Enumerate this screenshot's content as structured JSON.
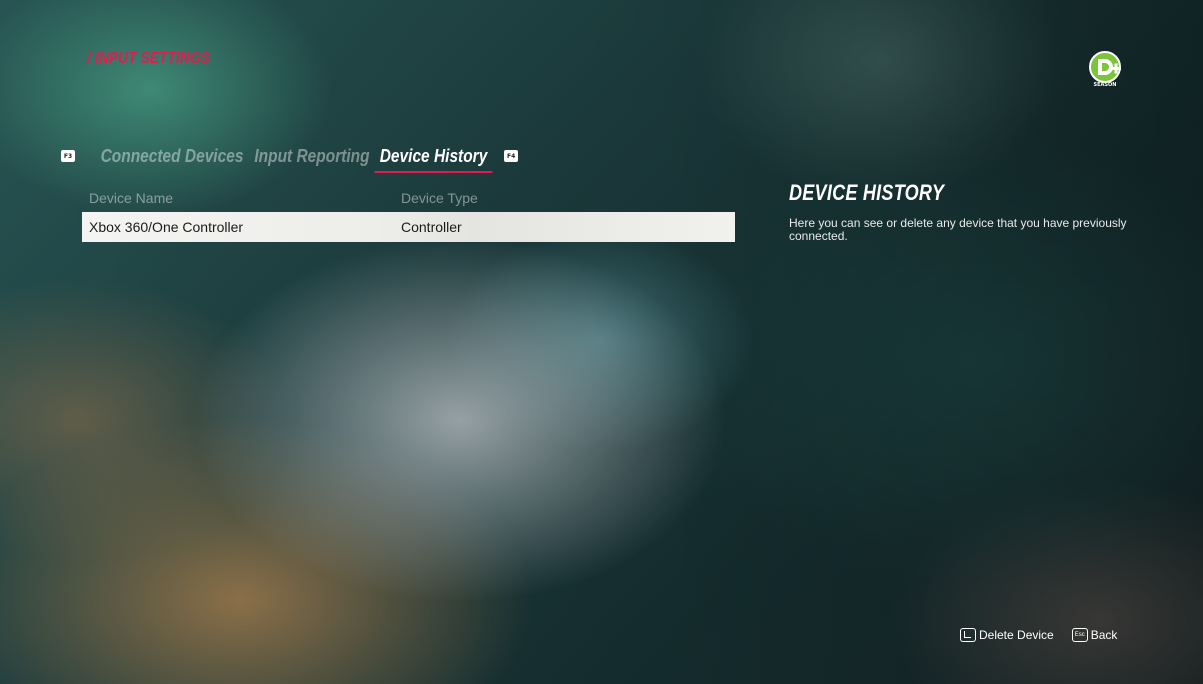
{
  "header": {
    "title": "/ INPUT SETTINGS",
    "badge_label": "SEASON"
  },
  "tabs": {
    "prev_key": "F3",
    "next_key": "F4",
    "items": [
      {
        "label": "Connected Devices",
        "active": false
      },
      {
        "label": "Input Reporting",
        "active": false
      },
      {
        "label": "Device History",
        "active": true
      }
    ]
  },
  "table": {
    "columns": [
      "Device Name",
      "Device Type"
    ],
    "rows": [
      {
        "name": "Xbox 360/One Controller",
        "type": "Controller"
      }
    ]
  },
  "info": {
    "title": "DEVICE HISTORY",
    "text": "Here you can see or delete any device that you have previously connected."
  },
  "footer": {
    "delete_label": "Delete Device",
    "back_label": "Back",
    "back_key": "Esc"
  },
  "colors": {
    "accent": "#e8194f",
    "badge_green": "#7cc43a"
  }
}
